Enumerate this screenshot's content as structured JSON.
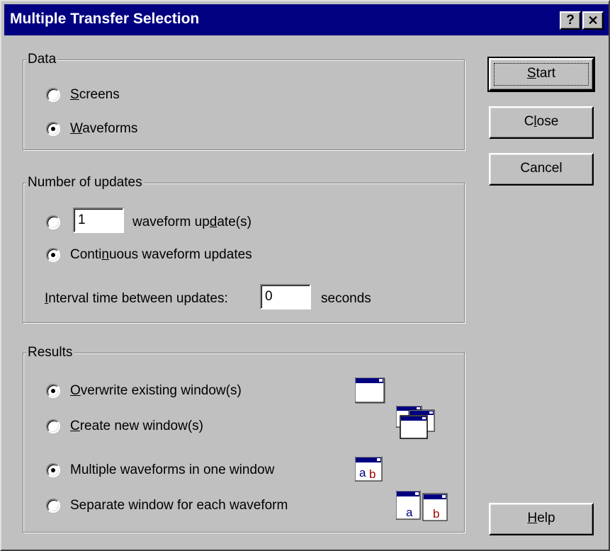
{
  "window": {
    "title": "Multiple Transfer Selection",
    "help_glyph": "?",
    "close_glyph": "✕"
  },
  "data_group": {
    "legend": "Data",
    "options": [
      {
        "underline": "S",
        "rest": "creens",
        "checked": false
      },
      {
        "underline": "W",
        "rest": "aveforms",
        "checked": true
      }
    ]
  },
  "updates_group": {
    "legend": "Number of updates",
    "count_value": "1",
    "count_label_pre": "waveform up",
    "count_label_u": "d",
    "count_label_post": "ate(s)",
    "continuous_pre": "Conti",
    "continuous_u": "n",
    "continuous_post": "uous waveform updates",
    "interval_u": "I",
    "interval_rest": "nterval time between updates:",
    "interval_value": "0",
    "interval_unit": "seconds",
    "count_checked": false,
    "continuous_checked": true
  },
  "results_group": {
    "legend": "Results",
    "overwrite_u": "O",
    "overwrite_rest": "verwrite existing window(s)",
    "create_u": "C",
    "create_rest": "reate new window(s)",
    "multiple": "Multiple waveforms in one window",
    "separate": "Separate window for each waveform",
    "overwrite_checked": true,
    "create_checked": false,
    "multiple_checked": true,
    "separate_checked": false,
    "icon_letters": {
      "a": "a",
      "b": "b"
    }
  },
  "buttons": {
    "start_u": "S",
    "start_rest": "tart",
    "close_pre": "C",
    "close_u": "l",
    "close_post": "ose",
    "cancel": "Cancel",
    "help_u": "H",
    "help_rest": "elp"
  },
  "colors": {
    "title_bg": "#000080",
    "face": "#c0c0c0",
    "icon_blue": "#000080",
    "icon_red": "#a00000"
  }
}
